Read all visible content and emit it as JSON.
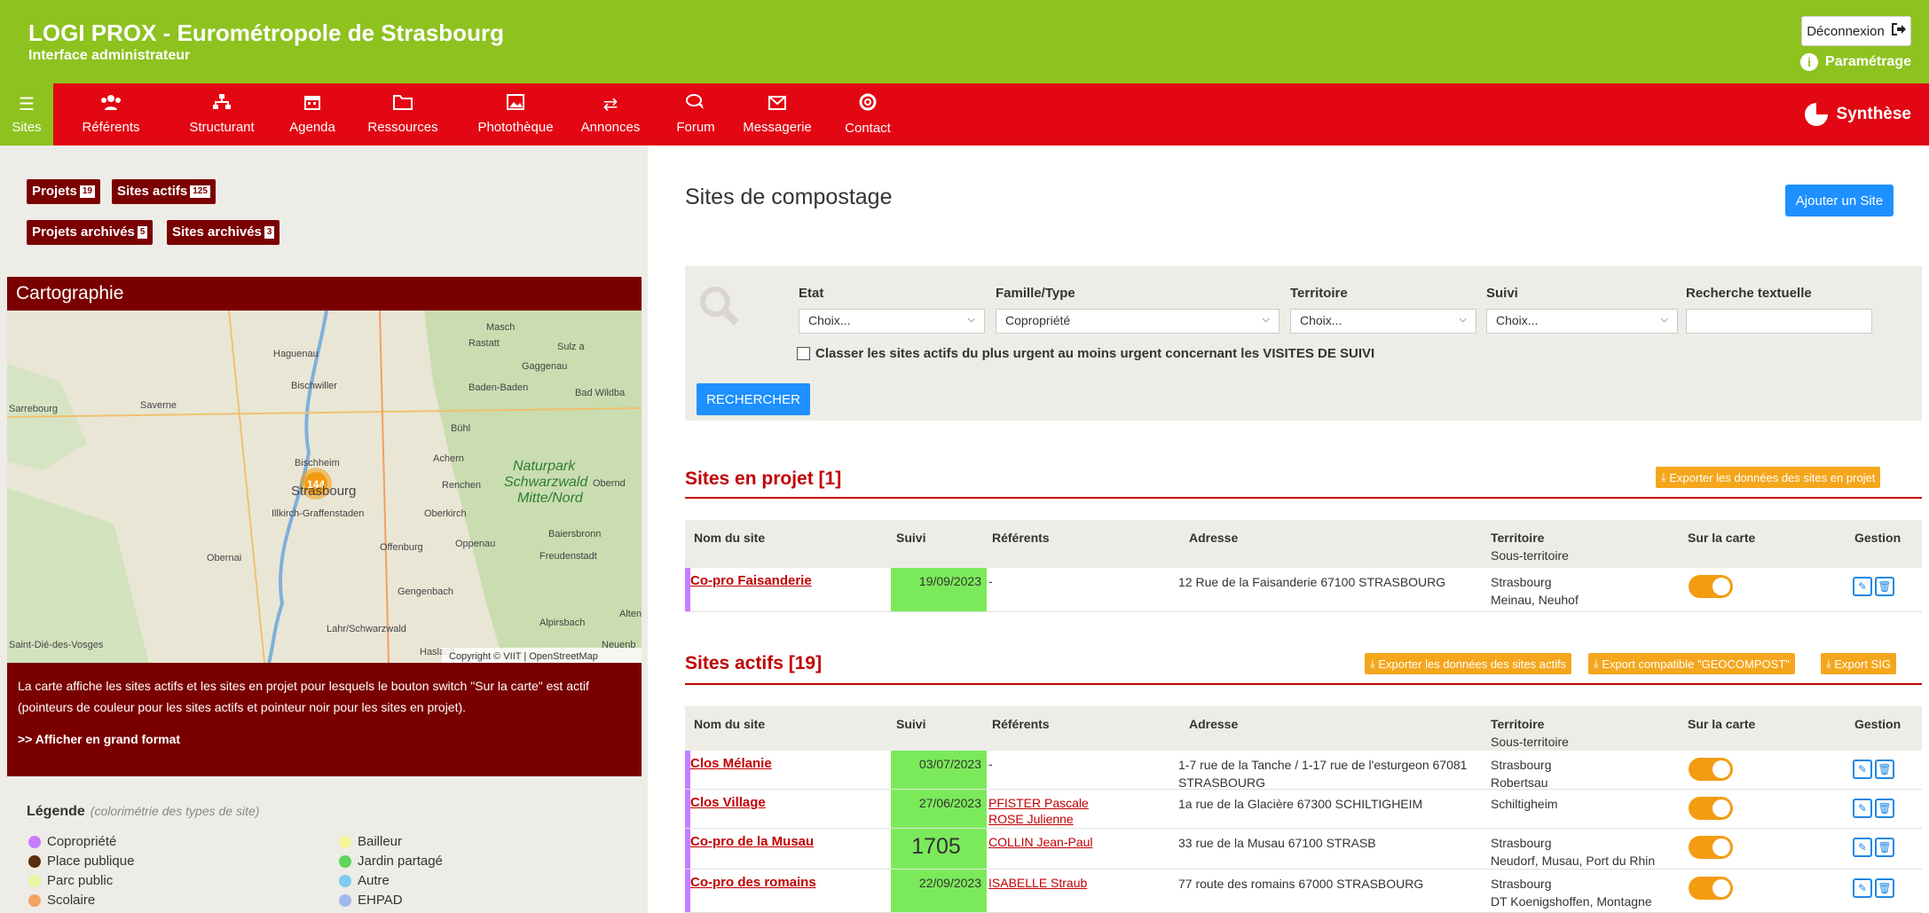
{
  "header": {
    "title": "LOGI PROX - Eurométropole de Strasbourg",
    "subtitle": "Interface administrateur",
    "logout": "Déconnexion",
    "settings": "Paramétrage"
  },
  "nav": {
    "items": [
      "Sites",
      "Référents",
      "Structurant",
      "Agenda",
      "Ressources",
      "Photothèque",
      "Annonces",
      "Forum",
      "Messagerie",
      "Contact"
    ],
    "icons": [
      "list-icon",
      "users-icon",
      "structure-icon",
      "calendar-icon",
      "folder-icon",
      "image-icon",
      "exchange-icon",
      "forum-icon",
      "mail-icon",
      "lifebuoy-icon"
    ],
    "synthese": "Synthèse"
  },
  "left": {
    "btn_projets": "Projets",
    "badge_projets": "19",
    "btn_sites_actifs": "Sites actifs",
    "badge_sites_actifs": "125",
    "btn_projets_archives": "Projets archivés",
    "badge_projets_archives": "5",
    "btn_sites_archives": "Sites archivés",
    "badge_sites_archives": "3",
    "carto_title": "Cartographie",
    "map": {
      "cluster": "144",
      "attribution": "Copyright © VIIT | OpenStreetMap",
      "labels": [
        "Haguenau",
        "Rastatt",
        "Gaggenau",
        "Bischwiller",
        "Baden-Baden",
        "Bad Wildba",
        "Sarrebourg",
        "Saverne",
        "Bühl",
        "Naturpark",
        "Schwarzwald",
        "Mitte/Nord",
        "Bischheim",
        "Strasbourg",
        "Renchen",
        "Illkirch-Graffenstaden",
        "Oberkirch",
        "Achern",
        "Obernai",
        "Offenburg",
        "Oppenau",
        "Baiersbronn",
        "Freudenstadt",
        "Gengenbach",
        "Alpirsbach",
        "Lahr/Schwarzwald",
        "Haslach",
        "Saint-Dié-des-Vosges",
        "Neuenb",
        "Altens",
        "Sulz a",
        "Obernd",
        "Masch"
      ]
    },
    "map_info": "La carte affiche les sites actifs et les sites en projet pour lesquels le bouton switch \"Sur la carte\" est actif (pointeurs de couleur pour les sites actifs et pointeur noir pour les sites en projet).",
    "map_more": ">> Afficher en grand format",
    "legend_title": "Légende",
    "legend_note": "(colorimétrie des types de site)",
    "legend": [
      {
        "label": "Copropriété",
        "color": "#c77dff"
      },
      {
        "label": "Place publique",
        "color": "#5a2d0c"
      },
      {
        "label": "Parc public",
        "color": "#e9f5a0"
      },
      {
        "label": "Scolaire",
        "color": "#f4a261"
      },
      {
        "label": "Bailleur",
        "color": "#f7f59a"
      },
      {
        "label": "Jardin partagé",
        "color": "#5cd65c"
      },
      {
        "label": "Autre",
        "color": "#7ecbf0"
      },
      {
        "label": "EHPAD",
        "color": "#a0b8f0"
      }
    ]
  },
  "main": {
    "title": "Sites de compostage",
    "add_site": "Ajouter un Site",
    "filters": {
      "etat": "Etat",
      "etat_value": "Choix...",
      "famille": "Famille/Type",
      "famille_value": "Copropriété",
      "territoire": "Territoire",
      "territoire_value": "Choix...",
      "suivi": "Suivi",
      "suivi_value": "Choix...",
      "recherche": "Recherche textuelle",
      "recherche_value": "",
      "checkbox_label": "Classer les sites actifs du plus urgent au moins urgent concernant les VISITES DE SUIVI",
      "search_btn": "RECHERCHER"
    },
    "columns": {
      "nom": "Nom du site",
      "suivi": "Suivi",
      "referents": "Référents",
      "adresse": "Adresse",
      "territoire": "Territoire",
      "sous_territoire": "Sous-territoire",
      "carte": "Sur la carte",
      "gestion": "Gestion"
    },
    "projets": {
      "title": "Sites en projet [1]",
      "export": "Exporter les données des sites en projet",
      "rows": [
        {
          "name": "Co-pro Faisanderie",
          "suivi": "19/09/2023",
          "referents": "-",
          "adresse": "12 Rue de la Faisanderie 67100 STRASBOURG",
          "territoire": "Strasbourg",
          "sous": "Meinau, Neuhof"
        }
      ]
    },
    "actifs": {
      "title": "Sites actifs [19]",
      "export1": "Exporter les données des sites actifs",
      "export2": "Export compatible \"GEOCOMPOST\"",
      "export3": "Export SIG",
      "rows": [
        {
          "name": "Clos Mélanie",
          "suivi": "03/07/2023",
          "ref1": "",
          "ref2": "",
          "referents": "-",
          "adresse": "1-7 rue de la Tanche / 1-17 rue de l'esturgeon 67081 STRASBOURG",
          "territoire": "Strasbourg",
          "sous": "Robertsau"
        },
        {
          "name": "Clos Village",
          "suivi": "27/06/2023",
          "ref1": "PFISTER Pascale",
          "ref2": "ROSE Julienne",
          "referents": "",
          "adresse": "1a rue de la Glacière 67300 SCHILTIGHEIM",
          "territoire": "Schiltigheim",
          "sous": ""
        },
        {
          "name": "Co-pro de la Musau",
          "suivi": "1705",
          "ref1": "COLLIN Jean-Paul",
          "ref2": "",
          "referents": "",
          "adresse": "33 rue de la Musau 67100 STRASB",
          "territoire": "Strasbourg",
          "sous": "Neudorf, Musau, Port du Rhin"
        },
        {
          "name": "Co-pro des romains",
          "suivi": "22/09/2023",
          "ref1": "ISABELLE Straub",
          "ref2": "",
          "referents": "",
          "adresse": "77 route des romains 67000 STRASBOURG",
          "territoire": "Strasbourg",
          "sous": "DT Koenigshoffen, Montagne"
        }
      ]
    }
  }
}
